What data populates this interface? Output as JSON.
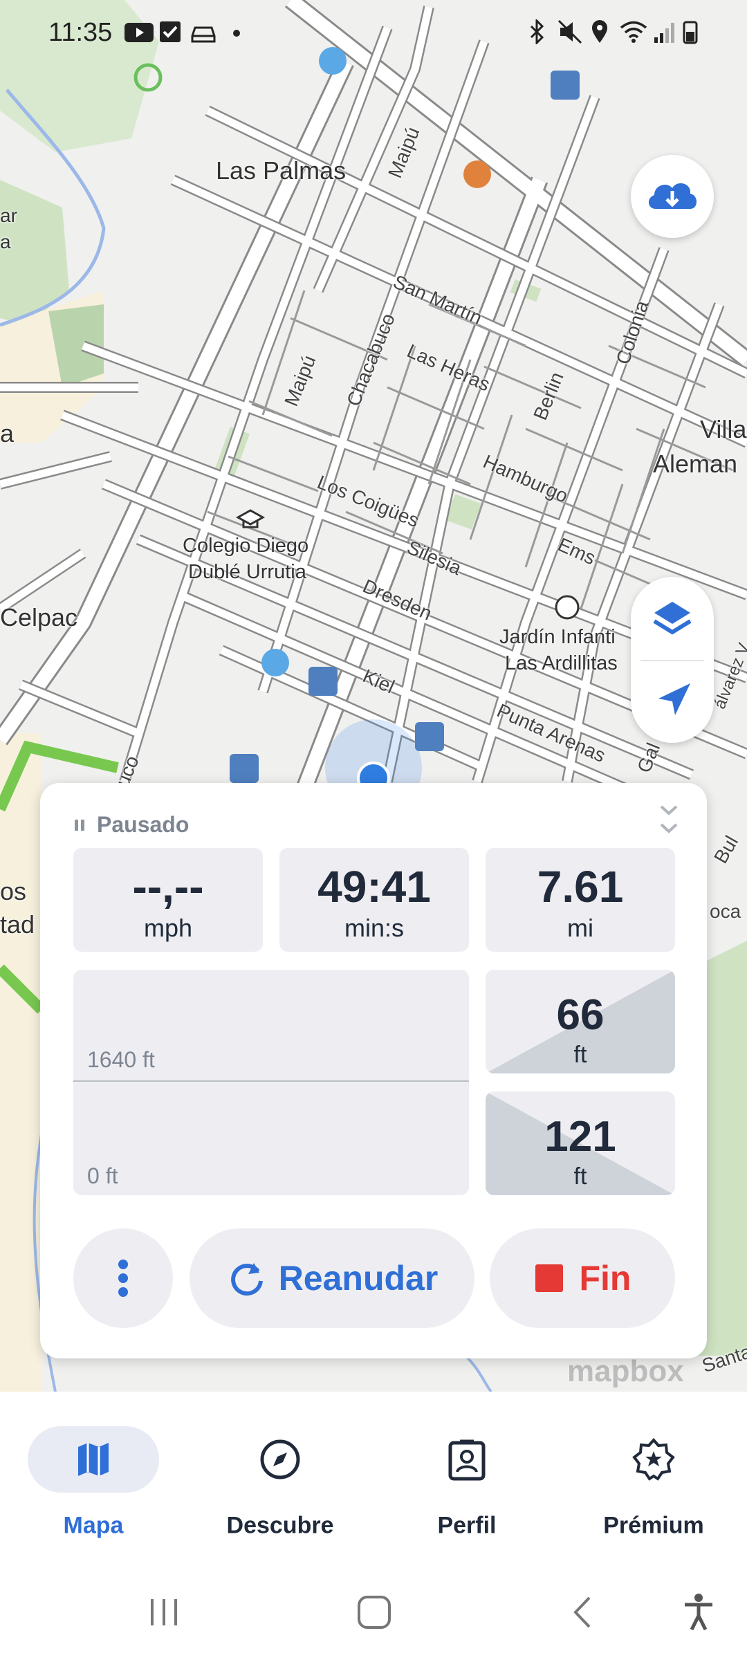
{
  "status_bar": {
    "time": "11:35",
    "icons": [
      "youtube-icon",
      "check-icon",
      "car-icon",
      "dot-icon",
      "bluetooth-icon",
      "mute-icon",
      "location-icon",
      "wifi-icon",
      "signal-icon",
      "battery-icon"
    ]
  },
  "map": {
    "places": [
      "Las Palmas",
      "Villa",
      "Aleman",
      "Celpac",
      "ar",
      "a",
      "a",
      "os",
      "tad"
    ],
    "pois": [
      "Colegio Diego",
      "Dublé Urrutia",
      "Jardín Infanti",
      "Las Ardillitas"
    ],
    "streets": [
      "Maipú",
      "San Martín",
      "Colonia",
      "Las Heras",
      "Chacabuco",
      "Maipú",
      "Berlin",
      "Hamburgo",
      "Los Coigües",
      "Silesia",
      "Ems",
      "Dresden",
      "Kiel",
      "Punta Arenas",
      "Gal",
      "uco",
      "Bul",
      "oca",
      "Santa",
      "álvarez V"
    ],
    "attribution": "mapbox",
    "colors": {
      "land": "#f0f0ef",
      "park": "#cfe3c3",
      "road": "#ffffff",
      "road_outline": "#8a8a8a",
      "route": "#78c850",
      "water": "#9cb8e8",
      "location": "#2f7de1"
    }
  },
  "fab": {
    "download": "cloud-download-icon",
    "layers": "layers-icon",
    "locate": "navigation-arrow-icon"
  },
  "panel": {
    "status": "Pausado",
    "stats": [
      {
        "value": "--,--",
        "unit": "mph"
      },
      {
        "value": "49:41",
        "unit": "min:s"
      },
      {
        "value": "7.61",
        "unit": "mi"
      }
    ],
    "elevation": {
      "top_label": "1640 ft",
      "bottom_label": "0 ft"
    },
    "ascent": {
      "value": "66",
      "unit": "ft"
    },
    "descent": {
      "value": "121",
      "unit": "ft"
    },
    "buttons": {
      "more": "more-vertical-icon",
      "resume": "Reanudar",
      "end": "Fin"
    },
    "accent": "#2f6fd6",
    "end_color": "#e53935"
  },
  "bottom_nav": {
    "items": [
      {
        "label": "Mapa",
        "icon": "map-icon",
        "active": true
      },
      {
        "label": "Descubre",
        "icon": "compass-icon",
        "active": false
      },
      {
        "label": "Perfil",
        "icon": "profile-icon",
        "active": false
      },
      {
        "label": "Prémium",
        "icon": "premium-badge-icon",
        "active": false
      }
    ]
  },
  "system_nav": [
    "recents-icon",
    "home-icon",
    "back-icon",
    "accessibility-icon"
  ]
}
